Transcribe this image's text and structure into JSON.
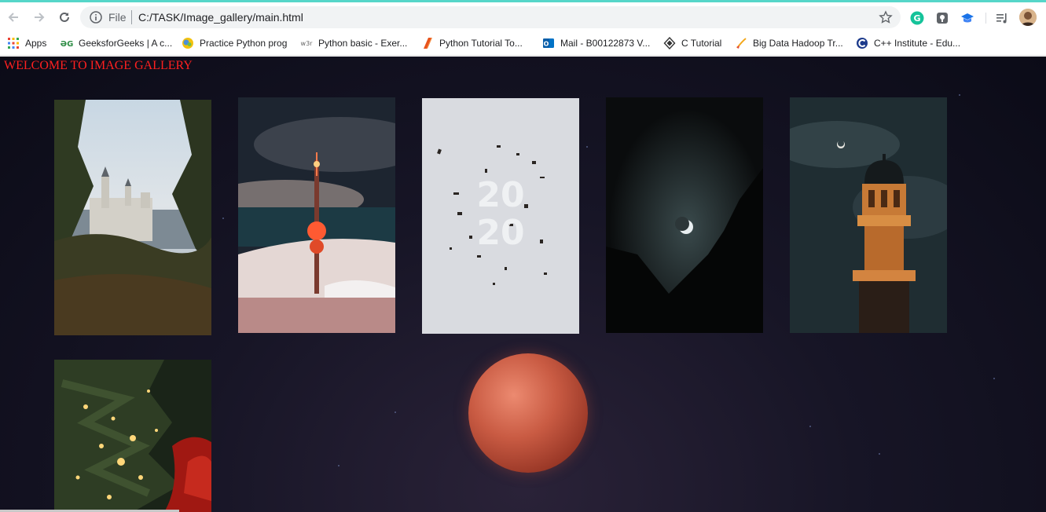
{
  "browser": {
    "file_label": "File",
    "url": "C:/TASK/Image_gallery/main.html"
  },
  "bookmarks": [
    {
      "label": "Apps",
      "icon": "apps-grid-icon"
    },
    {
      "label": "GeeksforGeeks | A c...",
      "icon": "geeksforgeeks-icon"
    },
    {
      "label": "Practice Python prog",
      "icon": "practice-python-icon"
    },
    {
      "label": "Python basic - Exer...",
      "icon": "w3resource-icon"
    },
    {
      "label": "Python Tutorial To...",
      "icon": "python-tutorial-icon"
    },
    {
      "label": "Mail - B00122873 V...",
      "icon": "outlook-mail-icon"
    },
    {
      "label": "C Tutorial",
      "icon": "c-tutorial-icon"
    },
    {
      "label": "Big Data Hadoop Tr...",
      "icon": "big-data-icon"
    },
    {
      "label": "C++ Institute - Edu...",
      "icon": "cpp-institute-icon"
    }
  ],
  "page": {
    "heading": "WELCOME TO IMAGE GALLERY",
    "gallery": [
      {
        "name": "castle-image"
      },
      {
        "name": "tower-image"
      },
      {
        "name": "2020-image",
        "overlay_text": [
          "20",
          "20"
        ]
      },
      {
        "name": "crescent-moon-image"
      },
      {
        "name": "minaret-image"
      },
      {
        "name": "christmas-tree-image"
      }
    ],
    "background_feature": "blood-moon"
  },
  "colors": {
    "heading": "#ff2020",
    "page_background": "#12121f",
    "accent_line": "#56d6c9"
  }
}
